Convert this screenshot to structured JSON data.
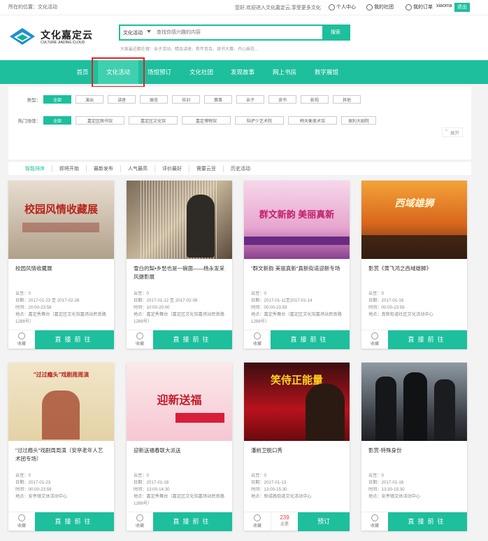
{
  "topbar": {
    "location": "所在的位置：文化活动",
    "welcome": "您好,欢迎进入文化嘉定云,享受更多文化",
    "user_center": "个人中心",
    "my_club": "我的社团",
    "my_orders": "我的订单",
    "username": "xiaoma",
    "logout": "退出"
  },
  "header": {
    "logo_cn": "文化嘉定云",
    "logo_en": "CULTURE JIADING CLOUD",
    "search_select": "文化活动",
    "search_placeholder": "查找你感兴趣的内容",
    "search_button": "搜索",
    "hot_search": "大家最近都在搜：亲子活动、精品讲座、新年音会、读书大赛、开心麻花..."
  },
  "nav": [
    "首页",
    "文化活动",
    "场馆预订",
    "文化社团",
    "发现故事",
    "网上书房",
    "数字展馆"
  ],
  "filter": {
    "type_label": "类型：",
    "types": [
      "全部",
      "演出",
      "讲座",
      "展览",
      "培训",
      "赛事",
      "亲子",
      "读书",
      "影视",
      "其他"
    ],
    "venue_label": "热门场馆：",
    "venues": [
      "全部",
      "嘉定区图书馆",
      "嘉定区文化馆",
      "嘉定博物馆",
      "陆俨少艺术院",
      "韩天衡美术馆",
      "保利大剧院"
    ],
    "expand": "展开"
  },
  "sorts": [
    "智能排序",
    "即将开始",
    "最新发布",
    "人气最高",
    "评价最好",
    "需要云豆",
    "历史活动"
  ],
  "cards": [
    {
      "title": "校园风情收藏展",
      "yundou": "云豆：0",
      "date": "日期：2017-01-23 至 2017-02-28",
      "time": "时间：20:00-23:58",
      "place": "地点：嘉定秀舞台（嘉定区文化馆嘉场站民南路1288号）",
      "fav": "收藏",
      "action": "直接前往",
      "img_text": "校园风情收藏展"
    },
    {
      "title": "雪白的梨•乡愁也是一碗面——杨永发采风摄影展",
      "yundou": "云豆：0",
      "date": "日期：2017-01-12 至 2017-02-08",
      "time": "时间：10:00-20:00",
      "place": "地点：嘉定秀舞台（嘉定区文化馆嘉场站民南路1288号）",
      "fav": "收藏",
      "action": "直接前往",
      "img_text": ""
    },
    {
      "title": "\"群文新韵 美丽真新\"真新街道迎新专场",
      "yundou": "云豆：0",
      "date": "日期：2017-01-11至2017-01-14",
      "time": "时间：00:00-23:59",
      "place": "地点：嘉定秀舞台（嘉定区文化馆嘉场站民南路1288号）",
      "fav": "收藏",
      "action": "直接前往",
      "img_text": "群文新韵 美丽真新"
    },
    {
      "title": "影赏《黄飞鸿之西域雄狮》",
      "yundou": "云豆：0",
      "date": "日期：2017-01-18",
      "time": "时间：00:00-23:59",
      "place": "地点：真新街道社区文化活动中心",
      "fav": "收藏",
      "action": "直接前往",
      "img_text": "西域雄狮"
    },
    {
      "title": "\"过过瘾头\"戏剧周周演（安亭老年人艺术团专场）",
      "yundou": "云豆：0",
      "date": "日期：2017-01-23",
      "time": "时间：00:00-23:59",
      "place": "地点：安亭镇文体活动中心",
      "fav": "收藏",
      "action": "直接前往",
      "img_text": "\"过过瘾头\"戏剧周周演"
    },
    {
      "title": "迎新送福春联大派送",
      "yundou": "云豆：0",
      "date": "日期：2017-01-18",
      "time": "时间：13:00-14:30",
      "place": "地点：嘉定秀舞台（嘉定区文化馆嘉场站民南路1288号）",
      "fav": "收藏",
      "action": "直接前往",
      "img_text": "迎新送福"
    },
    {
      "title": "潘前卫脱口秀",
      "yundou": "云豆：0",
      "date": "日期：2017-01-13",
      "time": "时间：13:00-15:30",
      "place": "地点：新成路街道文化活动中心",
      "fav": "收藏",
      "tickets": "239",
      "tickets_label": "余票",
      "action": "预订",
      "img_text": "笑侍正能量"
    },
    {
      "title": "影赏-特殊身份",
      "yundou": "云豆：0",
      "date": "日期：2017-01-16",
      "time": "时间：13:30-15:30",
      "place": "地点：安亭镇文体活动中心",
      "fav": "收藏",
      "action": "直接前往",
      "img_text": ""
    }
  ],
  "colors": {
    "accent": "#1dbf9d",
    "highlight": "#e02424"
  }
}
